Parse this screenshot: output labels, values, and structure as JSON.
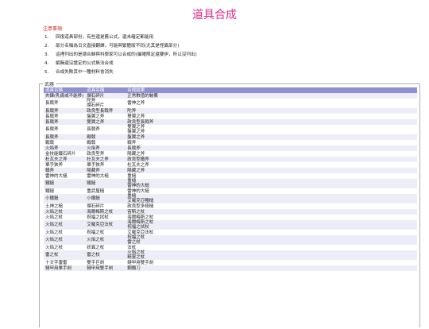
{
  "page_title": "道具合成",
  "notes_title": "注意事項",
  "notes": [
    {
      "num": "1.",
      "text": "回復道具部份，有些還是舊公式，還未確定都能用"
    },
    {
      "num": "2.",
      "text": "部分名稱為日文直接翻譯，可能與繁體版不同(尤其是怪異部分)"
    },
    {
      "num": "3.",
      "text": "這裡列出的是總合歸與科學家可以合成的(屬曜限定還要伊，所以沒列出)"
    },
    {
      "num": "4.",
      "text": "編輯還沒證定的公式無法合成"
    },
    {
      "num": "5.",
      "text": "合成失敗其中一種材料會消失"
    }
  ],
  "weapons": {
    "legend": "武器",
    "headers": [
      "道具名稱",
      "道具名稱",
      "合成結果"
    ],
    "rows": [
      {
        "a": [
          "夾鍊(乳痛或不能移)"
        ],
        "b": [
          "爛石碎片"
        ],
        "c": [
          "正常數值的裝備"
        ]
      },
      {
        "a": [
          "長戟斧"
        ],
        "b": [
          "陀斧",
          "爛石碎片"
        ],
        "c": [
          "雷神之斧"
        ]
      },
      {
        "a": [
          "長戟斧"
        ],
        "b": [
          "政良型長戟斧"
        ],
        "c": [
          "陀斧"
        ]
      },
      {
        "a": [
          "長戟斧"
        ],
        "b": [
          "盤翼之斧"
        ],
        "c": [
          "雙翼之斧"
        ]
      },
      {
        "a": [
          "長戟斧"
        ],
        "b": [
          "雙翼之斧"
        ],
        "c": [
          "政良型長戟斧"
        ]
      },
      {
        "a": [
          "長戟斧"
        ],
        "b": [
          "長戟斧"
        ],
        "c": [
          "雙翼之斧",
          "盤翼之斧"
        ]
      },
      {
        "a": [
          "長戟斧"
        ],
        "b": [
          "戰戟"
        ],
        "c": [
          "盤翼之斧"
        ]
      },
      {
        "a": [
          "戰戟"
        ],
        "b": [
          "戰戟"
        ],
        "c": [
          "戰斧"
        ]
      },
      {
        "a": [
          "火焰斧"
        ],
        "b": [
          "火焰斧"
        ],
        "c": [
          "長戟斧"
        ]
      },
      {
        "a": [
          "金技能鐵石碎片"
        ],
        "b": [
          "政良型斧"
        ],
        "c": [
          "陽藏之斧"
        ]
      },
      {
        "a": [
          "杜瓦夫之斧"
        ],
        "b": [
          "杜瓦夫之斧"
        ],
        "c": [
          "政良型鐵斧"
        ]
      },
      {
        "a": [
          "單手狹斧"
        ],
        "b": [
          "單手狹斧"
        ],
        "c": [
          "杜瓦夫之斧"
        ]
      },
      {
        "a": [
          "鐵斧"
        ],
        "b": [
          "陽藏斧"
        ],
        "c": [
          "陽藏之斧"
        ]
      },
      {
        "a": [
          "雷神的大槌"
        ],
        "b": [
          "雷神的大槌"
        ],
        "c": [
          "重槌"
        ]
      },
      {
        "a": [
          "鐵鎚"
        ],
        "b": [
          "鐵鎚"
        ],
        "c": [
          "重槌",
          "雷神的大槌"
        ]
      },
      {
        "a": [
          "鐵鎚"
        ],
        "b": [
          "重武屋槌"
        ],
        "c": [
          "雷神的大槌"
        ]
      },
      {
        "a": [
          "小鐵鎚"
        ],
        "b": [
          "小鐵鎚"
        ],
        "c": [
          "重槌",
          "艾羅克亞種槌"
        ]
      },
      {
        "a": [
          "土神之槌"
        ],
        "b": [
          "爛石碎片"
        ],
        "c": [
          "政良型多殺槌"
        ]
      },
      {
        "a": [
          "火焰之杖"
        ],
        "b": [
          "海爾梅斯之杖"
        ],
        "c": [
          "宙斯之杖"
        ]
      },
      {
        "a": [
          "火焰之杖"
        ],
        "b": [
          "祝福之拭杖"
        ],
        "c": [
          "海爾梅斯之杖"
        ]
      },
      {
        "a": [
          "火焰之杖"
        ],
        "b": [
          "艾羅克亞法杖"
        ],
        "c": [
          "海爾梅斯之杖",
          "祝福之拭杖"
        ]
      },
      {
        "a": [
          "火焰之杖"
        ],
        "b": [
          "祝福之杖"
        ],
        "c": [
          "艾羅克亞法杖"
        ]
      },
      {
        "a": [
          "火焰之杖"
        ],
        "b": [
          "火焰之杖"
        ],
        "c": [
          "祝福之杖",
          "雷之杖"
        ]
      },
      {
        "a": [
          "火焰之杖"
        ],
        "b": [
          "妖異之杖"
        ],
        "c": [
          "法杖"
        ]
      },
      {
        "a": [
          "雷之杖"
        ],
        "b": [
          "雷之杖"
        ],
        "c": [
          "火焰之杖",
          "精靈之杖"
        ]
      },
      {
        "a": [
          "十文字雷雷"
        ],
        "b": [
          "雙手巨劍"
        ],
        "c": [
          "鏈甲用雙手劍"
        ]
      },
      {
        "a": [
          "鏈甲用單手劍"
        ],
        "b": [
          "鏈甲用雙手劍"
        ],
        "c": [
          "鋼鐵刀"
        ]
      }
    ]
  }
}
